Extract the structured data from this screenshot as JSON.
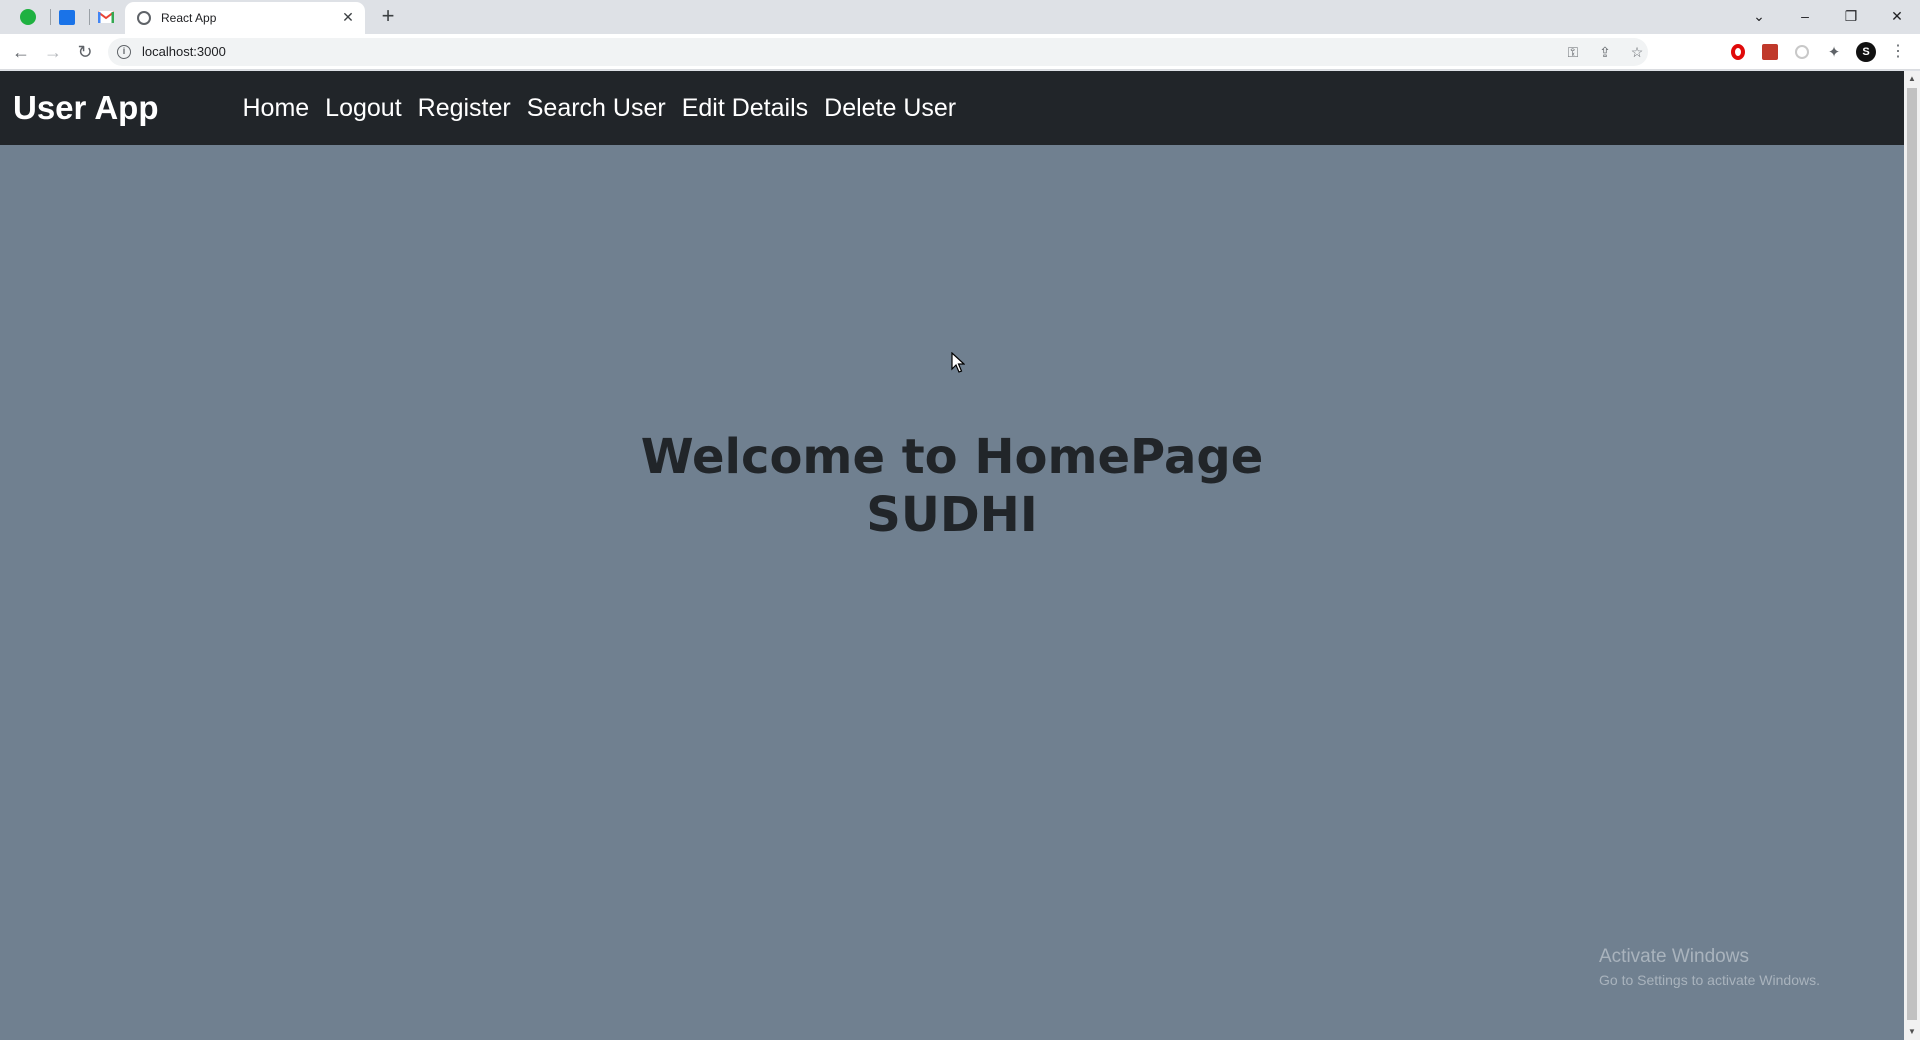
{
  "browser": {
    "tab_title": "React App",
    "new_tab_symbol": "+",
    "tab_close_symbol": "✕",
    "url": "localhost:3000",
    "profile_initial": "S",
    "window_controls": {
      "list": "⌄",
      "minimize": "–",
      "restore": "❐",
      "close": "✕"
    },
    "nav": {
      "back": "←",
      "forward": "→",
      "reload": "↻"
    },
    "omnibox_icons": {
      "key": "⚿",
      "share": "⇪",
      "star": "☆"
    },
    "menu": "⋮",
    "extensions_icon": "✦"
  },
  "app": {
    "brand": "User App",
    "nav_links": [
      "Home",
      "Logout",
      "Register",
      "Search User",
      "Edit Details",
      "Delete User"
    ],
    "welcome_line1": "Welcome to HomePage",
    "welcome_line2": "SUDHI"
  },
  "overlay": {
    "activate_title": "Activate Windows",
    "activate_subtitle": "Go to Settings to activate Windows."
  },
  "colors": {
    "page_bg": "#708090",
    "navbar_bg": "#212529",
    "heading": "#212529"
  }
}
